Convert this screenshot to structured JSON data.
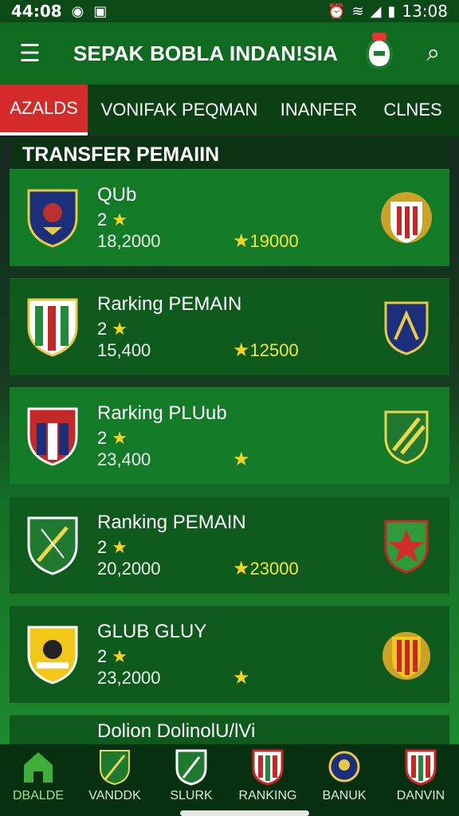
{
  "status": {
    "time": "44:08",
    "clock_right": "13:08"
  },
  "appbar": {
    "title": "SEPAK BOBLA INDAN!SIA"
  },
  "tabs": [
    {
      "label": "AZALDS",
      "active": true
    },
    {
      "label": "VONIFAK PEQMAN"
    },
    {
      "label": "INANFER"
    },
    {
      "label": "CLNES"
    }
  ],
  "section_title": "TRANSFER PEMAIIN",
  "cards": [
    {
      "name": "QUb",
      "rank": "2",
      "value": "18,2000",
      "points": "19000",
      "style": "light"
    },
    {
      "name": "Rarking PEMAIN",
      "rank": "2",
      "value": "15,400",
      "points": "12500",
      "style": "dark"
    },
    {
      "name": "Rarking PLUub",
      "rank": "2",
      "value": "23,400",
      "points": "",
      "style": "light"
    },
    {
      "name": "Ranking PEMAIN",
      "rank": "2",
      "value": "20,2000",
      "points": "23000",
      "style": "dark"
    },
    {
      "name": "GLUB GLUY",
      "rank": "2",
      "value": "23,2000",
      "points": "",
      "style": "dark"
    },
    {
      "name": "Dolion DolinolU/lVi",
      "rank": "",
      "value": "",
      "points": "",
      "style": "dark"
    }
  ],
  "bottom_nav": [
    {
      "label": "DBALDE",
      "icon": "home-icon",
      "active": true
    },
    {
      "label": "VANDDK",
      "icon": "crest-icon"
    },
    {
      "label": "SLURK",
      "icon": "crest-icon"
    },
    {
      "label": "RANKING",
      "icon": "crest-icon"
    },
    {
      "label": "BANUK",
      "icon": "crest-icon"
    },
    {
      "label": "DANVIN",
      "icon": "crest-icon"
    }
  ],
  "colors": {
    "primary": "#0e6b20",
    "accent": "#d42a2a",
    "star": "#f3d51a"
  }
}
